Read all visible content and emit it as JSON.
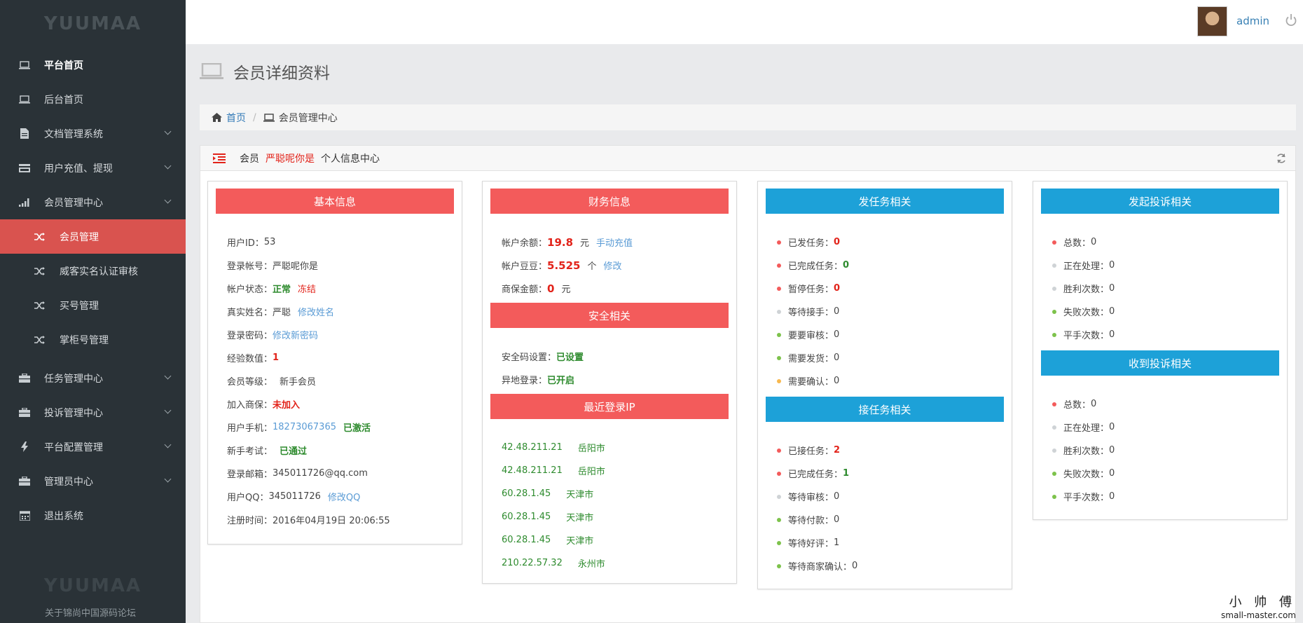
{
  "sidebar": {
    "logo": "YUUMAA",
    "items": [
      {
        "label": "平台首页",
        "icon": "laptop-icon"
      },
      {
        "label": "后台首页",
        "icon": "laptop-icon"
      },
      {
        "label": "文档管理系统",
        "icon": "file-icon"
      },
      {
        "label": "用户充值、提现",
        "icon": "card-icon"
      },
      {
        "label": "会员管理中心",
        "icon": "signal-icon"
      }
    ],
    "subitems": [
      {
        "label": "会员管理",
        "icon": "shuffle-icon"
      },
      {
        "label": "威客实名认证审核",
        "icon": "shuffle-icon"
      },
      {
        "label": "买号管理",
        "icon": "shuffle-icon"
      },
      {
        "label": "掌柜号管理",
        "icon": "shuffle-icon"
      }
    ],
    "items2": [
      {
        "label": "任务管理中心",
        "icon": "briefcase-icon"
      },
      {
        "label": "投诉管理中心",
        "icon": "briefcase-icon"
      },
      {
        "label": "平台配置管理",
        "icon": "bolt-icon"
      },
      {
        "label": "管理员中心",
        "icon": "briefcase-icon"
      },
      {
        "label": "退出系统",
        "icon": "calendar-icon"
      }
    ],
    "footer_logo": "YUUMAA",
    "footer_link": "关于锦尚中国源码论坛"
  },
  "topbar": {
    "username": "admin"
  },
  "page": {
    "title": "会员详细资料"
  },
  "breadcrumb": {
    "home": "首页",
    "current": "会员管理中心"
  },
  "box": {
    "prefix": "会员",
    "member_name": "严聪呢你是",
    "suffix": "个人信息中心"
  },
  "basic": {
    "title": "基本信息",
    "user_id_label": "用户ID：",
    "user_id": "53",
    "account_label": "登录帐号：",
    "account": "严聪呢你是",
    "status_label": "帐户状态：",
    "status_normal": "正常",
    "status_frozen": "冻结",
    "realname_label": "真实姓名：",
    "realname": "严聪",
    "realname_edit": "修改姓名",
    "password_label": "登录密码：",
    "password_edit": "修改新密码",
    "exp_label": "经验数值：",
    "exp": "1",
    "level_label": "会员等级：",
    "level": "新手会员",
    "guarantee_label": "加入商保：",
    "guarantee": "未加入",
    "phone_label": "用户手机：",
    "phone": "18273067365",
    "phone_status": "已激活",
    "exam_label": "新手考试：",
    "exam": "已通过",
    "email_label": "登录邮箱：",
    "email": "345011726@qq.com",
    "qq_label": "用户QQ：",
    "qq": "345011726",
    "qq_edit": "修改QQ",
    "reg_label": "注册时间：",
    "reg": "2016年04月19日 20:06:55"
  },
  "finance": {
    "title": "财务信息",
    "balance_label": "帐户余额：",
    "balance": "19.8",
    "balance_unit": "元",
    "recharge": "手动充值",
    "beans_label": "帐户豆豆：",
    "beans": "5.525",
    "beans_unit": "个",
    "beans_edit": "修改",
    "guarantee_label": "商保金额：",
    "guarantee": "0",
    "guarantee_unit": "元"
  },
  "security": {
    "title": "安全相关",
    "code_label": "安全码设置：",
    "code": "已设置",
    "remote_label": "异地登录：",
    "remote": "已开启"
  },
  "recent_ip": {
    "title": "最近登录IP",
    "rows": [
      {
        "ip": "42.48.211.21",
        "city": "岳阳市"
      },
      {
        "ip": "42.48.211.21",
        "city": "岳阳市"
      },
      {
        "ip": "60.28.1.45",
        "city": "天津市"
      },
      {
        "ip": "60.28.1.45",
        "city": "天津市"
      },
      {
        "ip": "60.28.1.45",
        "city": "天津市"
      },
      {
        "ip": "210.22.57.32",
        "city": "永州市"
      }
    ]
  },
  "publish_task": {
    "title": "发任务相关",
    "rows": [
      {
        "label": "已发任务：",
        "value": "0",
        "dot": "red",
        "style": "red"
      },
      {
        "label": "已完成任务：",
        "value": "0",
        "dot": "red",
        "style": "green"
      },
      {
        "label": "暂停任务：",
        "value": "0",
        "dot": "red",
        "style": "red"
      },
      {
        "label": "等待接手：",
        "value": "0",
        "dot": "gray",
        "style": "plain"
      },
      {
        "label": "要要审核：",
        "value": "0",
        "dot": "green",
        "style": "plain"
      },
      {
        "label": "需要发货：",
        "value": "0",
        "dot": "green",
        "style": "plain"
      },
      {
        "label": "需要确认：",
        "value": "0",
        "dot": "orange",
        "style": "plain"
      }
    ]
  },
  "accept_task": {
    "title": "接任务相关",
    "rows": [
      {
        "label": "已接任务：",
        "value": "2",
        "dot": "red",
        "style": "red"
      },
      {
        "label": "已完成任务：",
        "value": "1",
        "dot": "red",
        "style": "green"
      },
      {
        "label": "等待审核：",
        "value": "0",
        "dot": "gray",
        "style": "plain"
      },
      {
        "label": "等待付款：",
        "value": "0",
        "dot": "green",
        "style": "plain"
      },
      {
        "label": "等待好评：",
        "value": "1",
        "dot": "green",
        "style": "plain"
      },
      {
        "label": "等待商家确认：",
        "value": "0",
        "dot": "green",
        "style": "plain"
      }
    ]
  },
  "complaint_sent": {
    "title": "发起投诉相关",
    "rows": [
      {
        "label": "总数：",
        "value": "0",
        "dot": "red"
      },
      {
        "label": "正在处理：",
        "value": "0",
        "dot": "gray"
      },
      {
        "label": "胜利次数：",
        "value": "0",
        "dot": "gray"
      },
      {
        "label": "失败次数：",
        "value": "0",
        "dot": "green"
      },
      {
        "label": "平手次数：",
        "value": "0",
        "dot": "green"
      }
    ]
  },
  "complaint_received": {
    "title": "收到投诉相关",
    "rows": [
      {
        "label": "总数：",
        "value": "0",
        "dot": "red"
      },
      {
        "label": "正在处理：",
        "value": "0",
        "dot": "gray"
      },
      {
        "label": "胜利次数：",
        "value": "0",
        "dot": "gray"
      },
      {
        "label": "失败次数：",
        "value": "0",
        "dot": "green"
      },
      {
        "label": "平手次数：",
        "value": "0",
        "dot": "green"
      }
    ]
  },
  "watermark": {
    "line1": "小 帅 傅",
    "line2": "small-master.com"
  },
  "colors": {
    "sidebar_bg": "#2a3237",
    "active": "#d9534f",
    "red_header": "#f35b5b",
    "blue_header": "#1da1d8"
  }
}
